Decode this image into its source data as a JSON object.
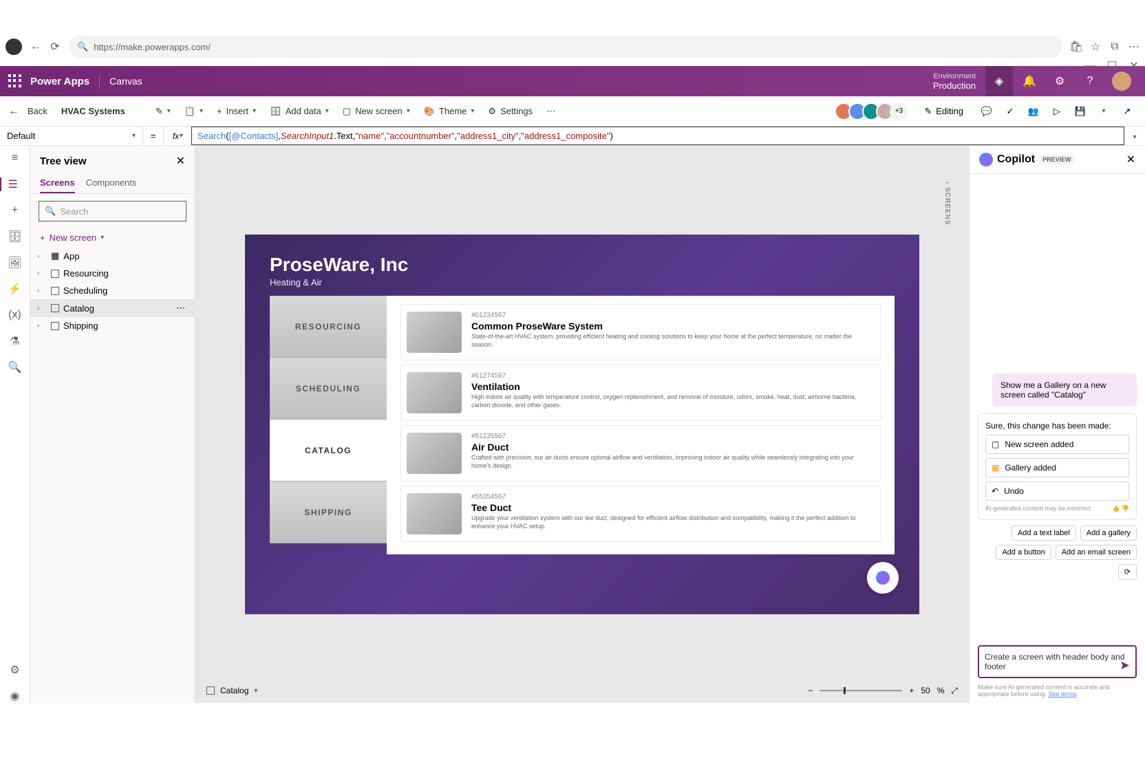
{
  "browser": {
    "url": "https://make.powerapps.com/"
  },
  "header": {
    "app": "Power Apps",
    "canvas": "Canvas",
    "envLabel": "Environment",
    "envName": "Production"
  },
  "commandBar": {
    "back": "Back",
    "appName": "HVAC Systems",
    "insert": "Insert",
    "addData": "Add data",
    "newScreen": "New screen",
    "theme": "Theme",
    "settings": "Settings",
    "editing": "Editing",
    "moreUsers": "+3"
  },
  "formula": {
    "property": "Default",
    "parts": {
      "fn": "Search",
      "open": "(",
      "contacts": "[@Contacts]",
      "comma1": ", ",
      "searchInput": "SearchInput1",
      "text": ".Text, ",
      "s1": "\"name\"",
      "c2": ", ",
      "s2": "\"accountnumber\"",
      "c3": ", ",
      "s3": "\"address1_city\"",
      "c4": ", ",
      "s4": "\"address1_composite\"",
      "close": ")"
    }
  },
  "tree": {
    "title": "Tree view",
    "tabScreens": "Screens",
    "tabComponents": "Components",
    "searchPlaceholder": "Search",
    "newScreen": "New screen",
    "items": [
      "App",
      "Resourcing",
      "Scheduling",
      "Catalog",
      "Shipping"
    ]
  },
  "stage": {
    "company": "ProseWare, Inc",
    "tagline": "Heating & Air",
    "nav": [
      "RESOURCING",
      "SCHEDULING",
      "CATALOG",
      "SHIPPING"
    ],
    "catalog": [
      {
        "sku": "#01234567",
        "name": "Common ProseWare System",
        "desc": "State-of-the-art HVAC system, providing efficient heating and cooling solutions to keep your home at the perfect temperature, no matter the season."
      },
      {
        "sku": "#61274567",
        "name": "Ventilation",
        "desc": "High indoor air quality with temperature control, oxygen replenishment, and removal of moisture, odors, smoke, heat, dust, airborne bacteria, carbon dioxide, and other gases."
      },
      {
        "sku": "#51235567",
        "name": "Air Duct",
        "desc": "Crafted with precision, our air ducts ensure optimal airflow and ventilation, improving indoor air quality while seamlessly integrating into your home's design."
      },
      {
        "sku": "#55354567",
        "name": "Tee Duct",
        "desc": "Upgrade your ventilation system with our tee duct, designed for efficient airflow distribution and compatibility, making it the perfect addition to enhance your HVAC setup."
      }
    ]
  },
  "canvasFooter": {
    "selected": "Catalog",
    "zoom": "50",
    "pct": "%"
  },
  "copilot": {
    "title": "Copilot",
    "preview": "PREVIEW",
    "userMsg": "Show me a Gallery on a new screen called \"Catalog\"",
    "botIntro": "Sure, this change has been made:",
    "action1": "New screen added",
    "action2": "Gallery added",
    "undo": "Undo",
    "disclaimer": "AI-generated content may be incorrect",
    "suggestions": [
      "Add a text label",
      "Add a gallery",
      "Add a button",
      "Add an email screen"
    ],
    "inputText": "Create a screen with header body and footer",
    "footer": "Make sure AI-generated content is accurate and appropriate before using.",
    "seeTerms": "See terms"
  },
  "sideTab": "SCREENS"
}
